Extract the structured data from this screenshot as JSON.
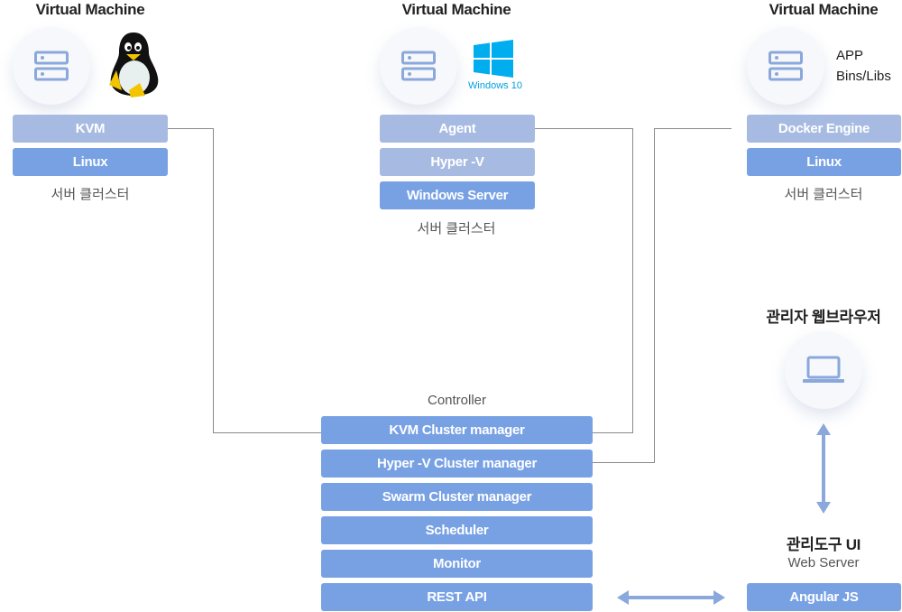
{
  "vm_left": {
    "title": "Virtual Machine",
    "os_icon": "linux-penguin-icon",
    "server_icon": "server-icon",
    "layers": [
      "KVM",
      "Linux"
    ],
    "caption": "서버 클러스터"
  },
  "vm_center": {
    "title": "Virtual Machine",
    "os_icon": "windows-logo-icon",
    "os_label": "Windows 10",
    "server_icon": "server-icon",
    "layers": [
      "Agent",
      "Hyper -V",
      "Windows Server"
    ],
    "caption": "서버 클러스터"
  },
  "vm_right": {
    "title": "Virtual Machine",
    "server_icon": "server-icon",
    "app_lines": [
      "APP",
      "Bins/Libs"
    ],
    "layers": [
      "Docker Engine",
      "Linux"
    ],
    "caption": "서버 클러스터"
  },
  "admin_browser": {
    "title": "관리자 웹브라우저",
    "icon": "laptop-icon"
  },
  "mgmt_ui": {
    "title": "관리도구 UI",
    "subtitle": "Web Server",
    "layer": "Angular JS"
  },
  "controller": {
    "title": "Controller",
    "modules": [
      "KVM Cluster manager",
      "Hyper -V Cluster manager",
      "Swarm Cluster manager",
      "Scheduler",
      "Monitor",
      "REST API"
    ]
  },
  "colors": {
    "light_box": "#a7bbe2",
    "dark_box": "#78a1e4",
    "icon_blue": "#8aa8dc",
    "connector": "#8a8a8a",
    "windows_blue": "#00adef"
  }
}
